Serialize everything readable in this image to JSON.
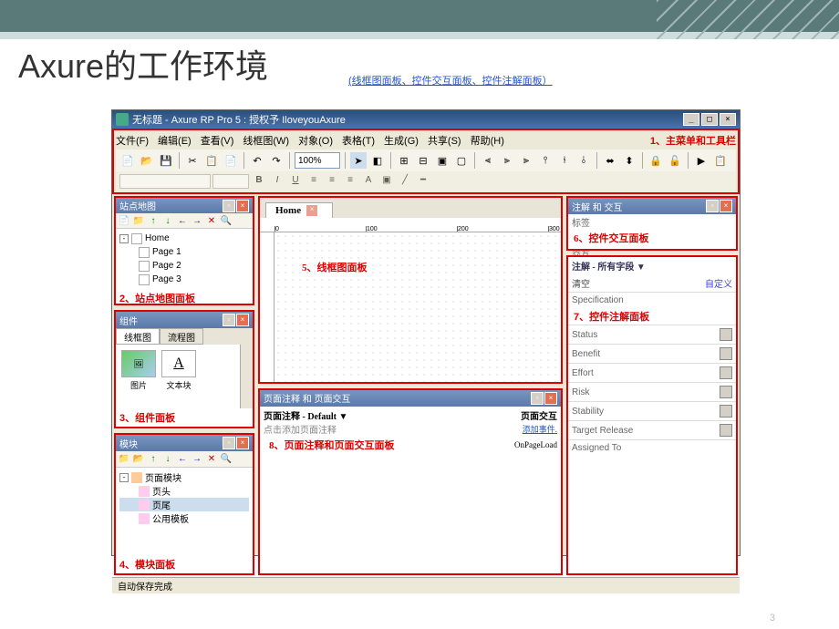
{
  "slide": {
    "title": "Axure的工作环境",
    "subtitle": "(线框图面板、控件交互面板、控件注解面板）",
    "page_num": "3"
  },
  "titlebar": {
    "text": "无标题 - Axure RP Pro 5 : 授权予 IloveyouAxure"
  },
  "menus": {
    "file": "文件(F)",
    "edit": "编辑(E)",
    "view": "查看(V)",
    "wireframe": "线框图(W)",
    "object": "对象(O)",
    "table": "表格(T)",
    "generate": "生成(G)",
    "share": "共享(S)",
    "help": "帮助(H)"
  },
  "labels": {
    "l1": "1、主菜单和工具栏",
    "l2": "2、站点地图面板",
    "l3": "3、组件面板",
    "l4": "4、模块面板",
    "l5": "5、线框图面板",
    "l6": "6、控件交互面板",
    "l7": "7、控件注解面板",
    "l8": "8、页面注释和页面交互面板"
  },
  "toolbar": {
    "zoom": "100%"
  },
  "sitemap": {
    "title": "站点地图",
    "root": "Home",
    "pages": [
      "Page 1",
      "Page 2",
      "Page 3"
    ]
  },
  "widgets": {
    "title": "组件",
    "tab1": "线框图",
    "tab2": "流程图",
    "img": "图片",
    "text": "文本块",
    "text_sym": "A"
  },
  "masters": {
    "title": "模块",
    "root": "页面模块",
    "items": [
      "页头",
      "页尾",
      "公用模板"
    ]
  },
  "canvas": {
    "tab": "Home",
    "ruler_marks": [
      "0",
      "100",
      "200",
      "300"
    ]
  },
  "pagenotes": {
    "title": "页面注释 和 页面交互",
    "left": "页面注释 - Default ▼",
    "right": "页面交互",
    "placeholder": "点击添加页面注释",
    "link": "添加事件.",
    "event": "OnPageLoad"
  },
  "annotations": {
    "title": "注解 和 交互",
    "label_tag": "标签",
    "interactions": "交互",
    "all_fields": "注解 - 所有字段 ▼",
    "clear": "清空",
    "custom": "自定义",
    "fields": [
      "Specification",
      "Status",
      "Benefit",
      "Effort",
      "Risk",
      "Stability",
      "Target Release",
      "Assigned To"
    ]
  },
  "statusbar": {
    "text": "自动保存完成"
  }
}
